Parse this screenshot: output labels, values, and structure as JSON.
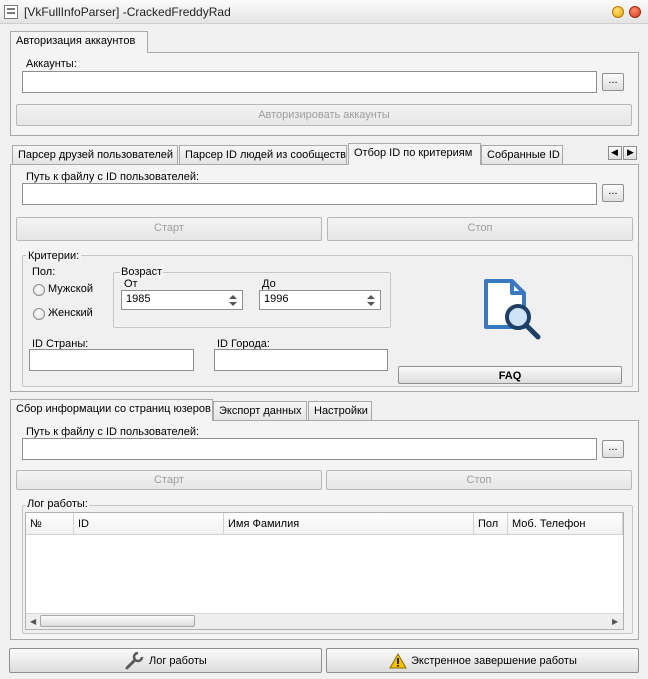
{
  "window": {
    "title": "[VkFullInfoParser] -CrackedFreddyRad"
  },
  "auth": {
    "tab_label": "Авторизация аккаунтов",
    "accounts_label": "Аккаунты:",
    "accounts_value": "",
    "browse_label": "...",
    "authorize_button": "Авторизировать аккаунты"
  },
  "parser_tabs": {
    "tabs": [
      {
        "label": "Парсер друзей пользователей",
        "active": false
      },
      {
        "label": "Парсер ID людей из сообществ",
        "active": false
      },
      {
        "label": "Отбор ID по критериям",
        "active": true
      },
      {
        "label": "Собранные ID",
        "active": false
      }
    ],
    "nav_left": "◀",
    "nav_right": "▶",
    "file_label": "Путь к файлу с ID пользователей:",
    "file_value": "",
    "browse_label": "...",
    "start_button": "Старт",
    "stop_button": "Стоп",
    "criteria": {
      "title": "Критерии:",
      "gender_label": "Пол:",
      "gender_options": [
        "Мужской",
        "Женский"
      ],
      "age_label": "Возраст",
      "from_label": "От",
      "from_value": "1985",
      "to_label": "До",
      "to_value": "1996",
      "country_label": "ID Страны:",
      "country_value": "",
      "city_label": "ID Города:",
      "city_value": "",
      "faq_button": "FAQ",
      "faq_icon": "document-search-icon",
      "faq_icon_color": "#3a78c2"
    }
  },
  "info_tabs": {
    "tabs": [
      {
        "label": "Сбор информации со страниц юзеров",
        "active": true
      },
      {
        "label": "Экспорт данных",
        "active": false
      },
      {
        "label": "Настройки",
        "active": false
      }
    ],
    "file_label": "Путь к файлу с ID пользователей:",
    "file_value": "",
    "browse_label": "...",
    "start_button": "Старт",
    "stop_button": "Стоп",
    "log_label": "Лог работы:",
    "table": {
      "columns": [
        "№",
        "ID",
        "Имя Фамилия",
        "Пол",
        "Моб. Телефон"
      ],
      "rows": []
    }
  },
  "footer": {
    "log_button": "Лог работы",
    "log_icon": "wrench-icon",
    "emergency_button": "Экстренное завершение работы",
    "emergency_icon": "warning-icon",
    "warning_color": "#f2c200"
  }
}
